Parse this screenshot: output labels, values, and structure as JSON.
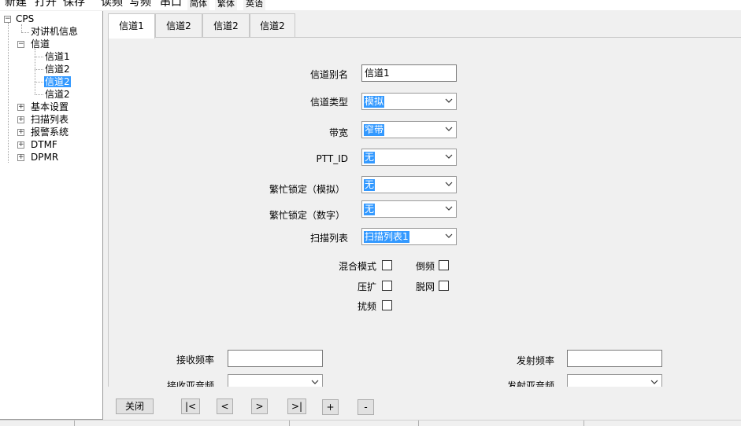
{
  "toolbar": {
    "new": "新建",
    "open": "打开",
    "save": "保存",
    "read": "读频",
    "write": "写频",
    "port": "串口",
    "simplified": "简体",
    "traditional": "繁体",
    "english": "英语"
  },
  "tree": {
    "root": "CPS",
    "intercom_info": "对讲机信息",
    "channel": "信道",
    "channels": [
      "信道1",
      "信道2",
      "信道2",
      "信道2"
    ],
    "basic_settings": "基本设置",
    "scan_list": "扫描列表",
    "alarm_system": "报警系统",
    "dtmf": "DTMF",
    "dpmr": "DPMR"
  },
  "tabs": [
    "信道1",
    "信道2",
    "信道2",
    "信道2"
  ],
  "form": {
    "alias_label": "信道别名",
    "alias_value": "信道1",
    "type_label": "信道类型",
    "type_value": "模拟",
    "bandwidth_label": "带宽",
    "bandwidth_value": "窄带",
    "ptt_label": "PTT_ID",
    "ptt_value": "无",
    "busy_analog_label": "繁忙锁定（模拟）",
    "busy_analog_value": "无",
    "busy_digital_label": "繁忙锁定（数字）",
    "busy_digital_value": "无",
    "scanlist_label": "扫描列表",
    "scanlist_value": "扫描列表1",
    "mixed_mode": "混合模式",
    "reverse": "倒频",
    "compand": "压扩",
    "offnet": "脱网",
    "scramble": "扰频",
    "rx_freq_label": "接收频率",
    "rx_freq_value": "",
    "tx_freq_label": "发射频率",
    "tx_freq_value": "",
    "rx_tone_label": "接收亚音频",
    "tx_tone_label": "发射亚音频"
  },
  "nav": {
    "close": "关闭",
    "first": "|<",
    "prev": "<",
    "next": ">",
    "last": ">|",
    "add": "+",
    "remove": "-"
  },
  "colors": {
    "selection": "#3399ff",
    "panel_bg": "#f0f0f0"
  }
}
